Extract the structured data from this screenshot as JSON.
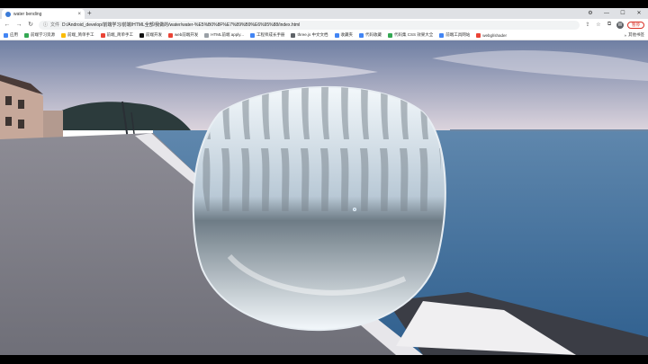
{
  "browser": {
    "tab": {
      "title": "water bending"
    },
    "new_tab_glyph": "+",
    "tab_close_glyph": "×",
    "window_controls": [
      "⚙",
      "—",
      "☐",
      "✕"
    ],
    "nav": {
      "back": "←",
      "forward": "→",
      "reload": "↻"
    },
    "address": {
      "security_label": "文件",
      "url": "D:/Android_develop/前端学习/前端/HTML全部/我做的/water/water-%E5%B0%8F%E7%89%B9%E6%95%88/index.html"
    },
    "toolbar_right": {
      "share": "⇪",
      "star": "☆",
      "extensions": "⧉",
      "avatar": "W",
      "pause_label": "暂停"
    }
  },
  "bookmarks": [
    {
      "label": "应用",
      "color": "#4285f4"
    },
    {
      "label": "前端学习资源",
      "color": "#34a853"
    },
    {
      "label": "前端_简单手工",
      "color": "#fbbc05"
    },
    {
      "label": "前端_简单手工",
      "color": "#ea4335"
    },
    {
      "label": "前端开发",
      "color": "#111111"
    },
    {
      "label": "web前端开发",
      "color": "#ea4335"
    },
    {
      "label": "HTML前端 apply...",
      "color": "#9aa0a6"
    },
    {
      "label": "工程师成长手册",
      "color": "#4285f4"
    },
    {
      "label": "three.js 中文文档",
      "color": "#5f6368"
    },
    {
      "label": "收藏夹",
      "color": "#4285f4"
    },
    {
      "label": "代码收藏",
      "color": "#4285f4"
    },
    {
      "label": "代码集 CSS 效果大全",
      "color": "#34a853"
    },
    {
      "label": "前端工具网站",
      "color": "#4285f4"
    },
    {
      "label": "webgl/shader",
      "color": "#ea4335"
    }
  ],
  "bookmarks_more": {
    "glyph": "»",
    "label": "其他书签"
  },
  "scene": {
    "colors": {
      "sky_top": "#6f7fa3",
      "sky_horizon": "#dcd4dd",
      "sea_far": "#5f87ad",
      "sea_near": "#2f5f8e",
      "pavement": "#6f6f78",
      "water_blob_light": "#f3f8fb",
      "water_blob_mid": "#b9c9d6",
      "water_blob_dark": "#6e7c86"
    }
  }
}
